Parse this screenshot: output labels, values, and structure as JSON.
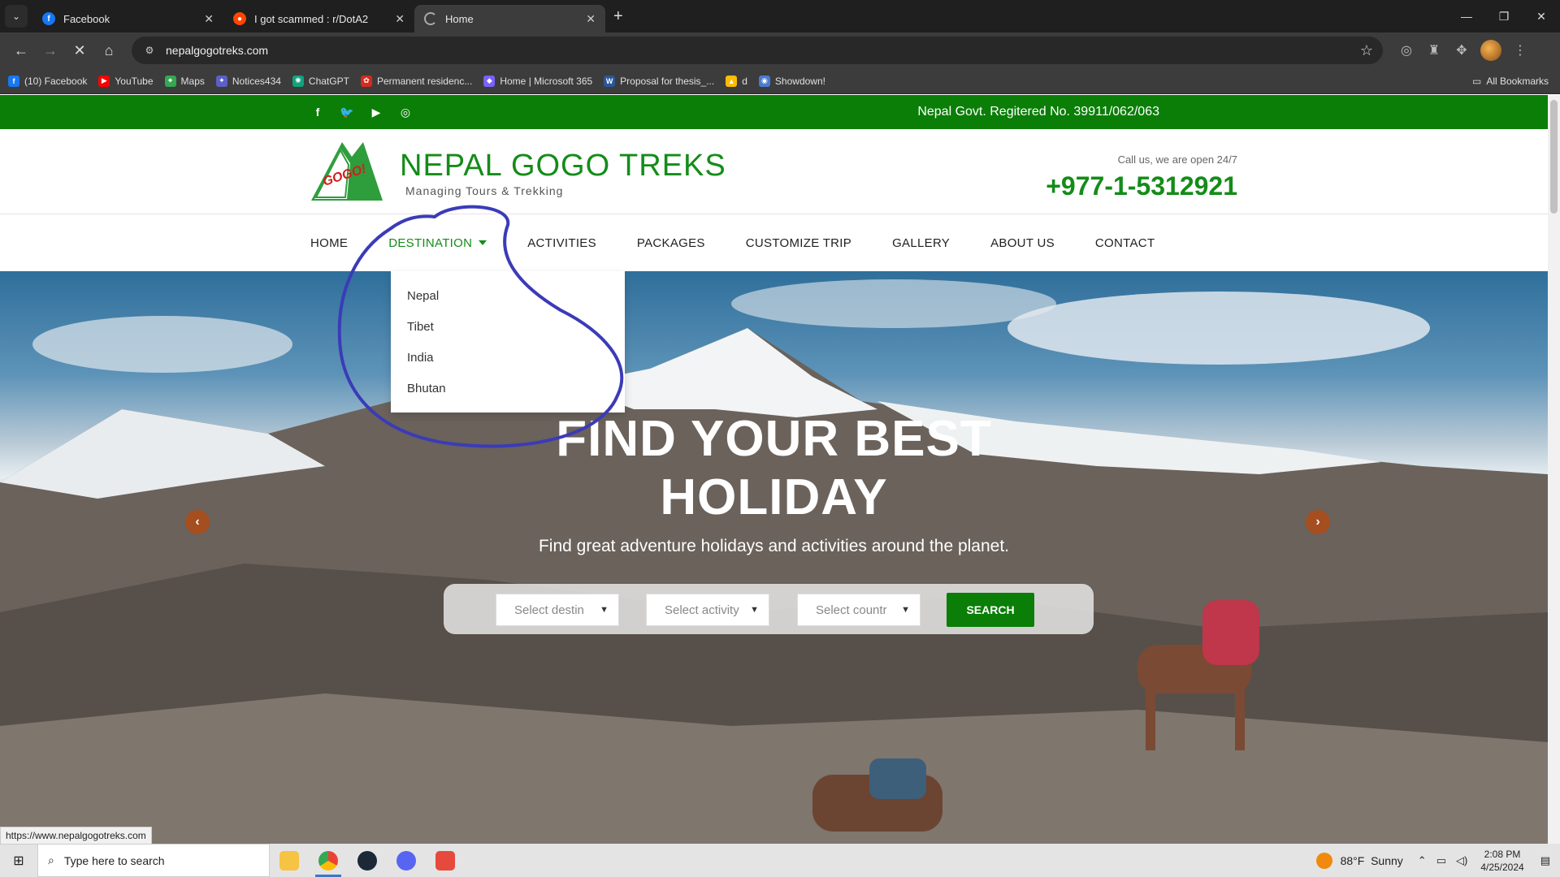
{
  "browser": {
    "tabs": [
      {
        "title": "Facebook",
        "icon": "facebook-icon",
        "color": "#1877f2"
      },
      {
        "title": "I got scammed : r/DotA2",
        "icon": "reddit-icon",
        "color": "#ff4500"
      },
      {
        "title": "Home",
        "icon": "loading-icon",
        "color": "#888888"
      }
    ],
    "url": "nepalgogotreks.com",
    "bookmarks": [
      {
        "label": "(10) Facebook",
        "icon": "facebook-icon",
        "color": "#1877f2"
      },
      {
        "label": "YouTube",
        "icon": "youtube-icon",
        "color": "#ff0000"
      },
      {
        "label": "Maps",
        "icon": "maps-icon",
        "color": "#34a853"
      },
      {
        "label": "Notices434",
        "icon": "notices-icon",
        "color": "#5b5fc7"
      },
      {
        "label": "ChatGPT",
        "icon": "chatgpt-icon",
        "color": "#10a37f"
      },
      {
        "label": "Permanent residenc...",
        "icon": "maple-leaf-icon",
        "color": "#d52b1e"
      },
      {
        "label": "Home | Microsoft 365",
        "icon": "microsoft365-icon",
        "color": "#7b61ff"
      },
      {
        "label": "Proposal for thesis_...",
        "icon": "word-icon",
        "color": "#2b579a"
      },
      {
        "label": "d",
        "icon": "drive-icon",
        "color": "#fbbc04"
      },
      {
        "label": "Showdown!",
        "icon": "showdown-icon",
        "color": "#4a7bd0"
      }
    ],
    "all_bookmarks": "All Bookmarks",
    "status_url": "https://www.nepalgogotreks.com"
  },
  "site": {
    "reg_no": "Nepal Govt. Regitered No. 39911/062/063",
    "brand": "NEPAL GOGO TREKS",
    "tagline": "Managing Tours & Trekking",
    "logo_text": "GOGO!",
    "call_us": "Call us, we are open 24/7",
    "phone": "+977-1-5312921",
    "nav": [
      "HOME",
      "DESTINATION",
      "ACTIVITIES",
      "PACKAGES",
      "CUSTOMIZE TRIP",
      "GALLERY",
      "ABOUT US",
      "CONTACT"
    ],
    "destination_menu": [
      "Nepal",
      "Tibet",
      "India",
      "Bhutan"
    ],
    "hero_title_line1": "FIND YOUR BEST",
    "hero_title_line2": "HOLIDAY",
    "hero_sub": "Find great adventure holidays and activities around the planet.",
    "search": {
      "destination_placeholder": "Select destin",
      "activity_placeholder": "Select activity",
      "country_placeholder": "Select countr",
      "button": "SEARCH"
    },
    "colors": {
      "green": "#0a7e07",
      "brand": "#148c19",
      "arrow": "#a54e1f"
    }
  },
  "taskbar": {
    "search_placeholder": "Type here to search",
    "weather": "88°F  Sunny",
    "time": "2:08 PM",
    "date": "4/25/2024"
  }
}
